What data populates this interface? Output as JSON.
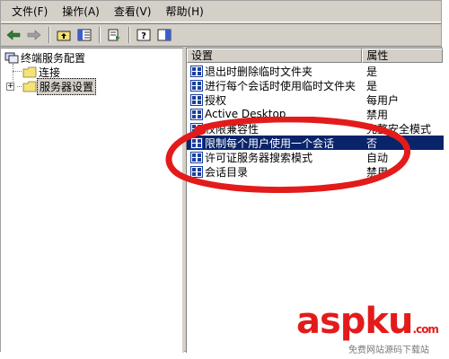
{
  "menu": {
    "file": "文件(F)",
    "action": "操作(A)",
    "view": "查看(V)",
    "help": "帮助(H)"
  },
  "tree": {
    "root": "终端服务配置",
    "connections": "连接",
    "server_settings": "服务器设置"
  },
  "list": {
    "headers": {
      "setting": "设置",
      "attribute": "属性"
    },
    "rows": [
      {
        "name": "退出时删除临时文件夹",
        "value": "是"
      },
      {
        "name": "进行每个会话时使用临时文件夹",
        "value": "是"
      },
      {
        "name": "授权",
        "value": "每用户"
      },
      {
        "name": "Active Desktop",
        "value": "禁用"
      },
      {
        "name": "权限兼容性",
        "value": "完整安全模式"
      },
      {
        "name": "限制每个用户使用一个会话",
        "value": "否"
      },
      {
        "name": "许可证服务器搜索模式",
        "value": "自动"
      },
      {
        "name": "会话目录",
        "value": "禁用"
      }
    ],
    "selected_index": 5
  },
  "watermark": {
    "brand": "aspku",
    "brand_suffix": ".com",
    "tagline": "免费网站源码下载站"
  },
  "colors": {
    "selection": "#0a246a",
    "annotation": "#e31b1b"
  }
}
